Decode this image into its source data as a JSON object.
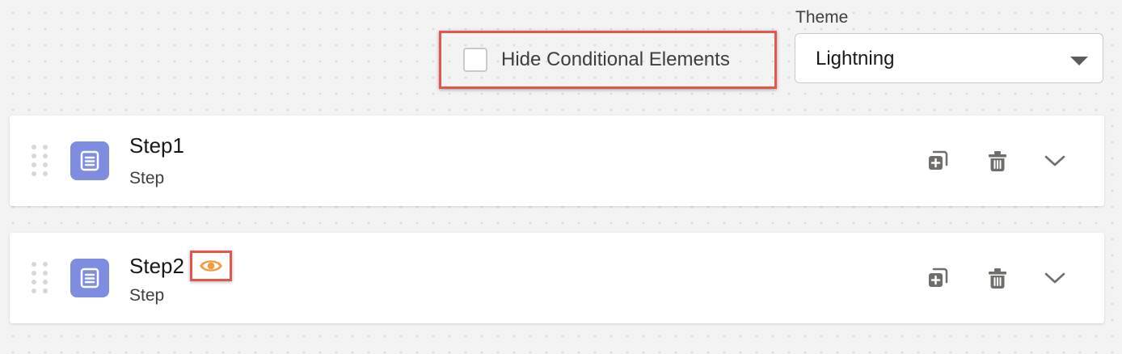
{
  "toolbar": {
    "hide_conditional_label": "Hide Conditional Elements",
    "hide_conditional_checked": false,
    "theme_label": "Theme",
    "theme_value": "Lightning"
  },
  "steps": [
    {
      "title": "Step1",
      "subtitle": "Step",
      "has_visibility_rule": false,
      "icon": "step-icon"
    },
    {
      "title": "Step2",
      "subtitle": "Step",
      "has_visibility_rule": true,
      "icon": "step-icon"
    }
  ],
  "actions": [
    "duplicate-icon",
    "delete-icon",
    "chevron-down-icon"
  ],
  "colors": {
    "step_icon_bg": "#7f8de1",
    "highlight_border": "#e2574c",
    "visibility_icon": "#f49b3f",
    "action_icon": "#706e6b"
  }
}
